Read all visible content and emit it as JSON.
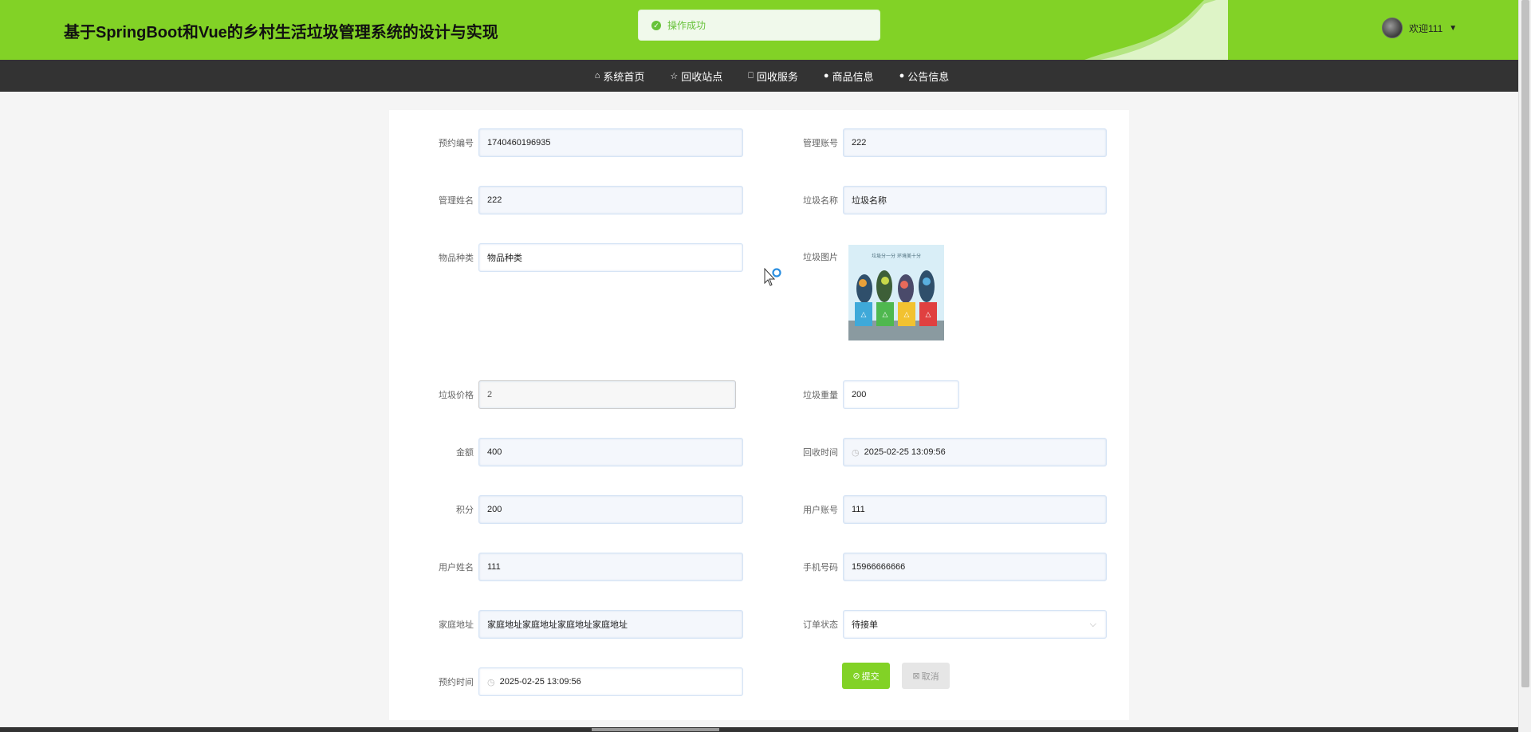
{
  "header": {
    "title": "基于SpringBoot和Vue的乡村生活垃圾管理系统的设计与实现",
    "welcome": "欢迎111"
  },
  "toast": {
    "message": "操作成功"
  },
  "nav": [
    {
      "label": "系统首页",
      "icon": "home-icon"
    },
    {
      "label": "回收站点",
      "icon": "star-icon"
    },
    {
      "label": "回收服务",
      "icon": "bag-icon"
    },
    {
      "label": "商品信息",
      "icon": "info-icon"
    },
    {
      "label": "公告信息",
      "icon": "question-icon"
    }
  ],
  "form": {
    "booking_no": {
      "label": "预约编号",
      "value": "1740460196935"
    },
    "admin_account": {
      "label": "管理账号",
      "value": "222"
    },
    "admin_name": {
      "label": "管理姓名",
      "value": "222"
    },
    "garbage_name": {
      "label": "垃圾名称",
      "value": "垃圾名称"
    },
    "item_category": {
      "label": "物品种类",
      "value": "物品种类"
    },
    "garbage_image": {
      "label": "垃圾图片",
      "caption": "垃圾分一分 环境美十分"
    },
    "garbage_price": {
      "label": "垃圾价格",
      "value": "2"
    },
    "garbage_weight": {
      "label": "垃圾重量",
      "value": "200"
    },
    "amount": {
      "label": "金额",
      "value": "400"
    },
    "recycle_time": {
      "label": "回收时间",
      "value": "2025-02-25 13:09:56"
    },
    "points": {
      "label": "积分",
      "value": "200"
    },
    "user_account": {
      "label": "用户账号",
      "value": "111"
    },
    "user_name": {
      "label": "用户姓名",
      "value": "111"
    },
    "phone": {
      "label": "手机号码",
      "value": "15966666666"
    },
    "home_address": {
      "label": "家庭地址",
      "value": "家庭地址家庭地址家庭地址家庭地址"
    },
    "order_status": {
      "label": "订单状态",
      "value": "待接单"
    },
    "booking_time": {
      "label": "预约时间",
      "value": "2025-02-25 13:09:56"
    }
  },
  "buttons": {
    "submit": "提交",
    "cancel": "取消"
  },
  "colors": {
    "accent": "#82d226",
    "nav_bg": "#333333",
    "success": "#67c23a"
  }
}
